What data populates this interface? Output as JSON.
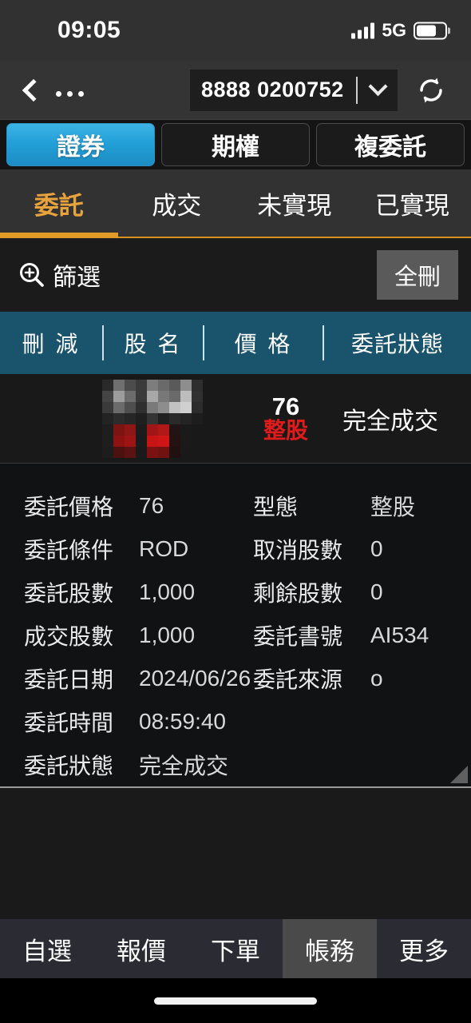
{
  "status_bar": {
    "time": "09:05",
    "network": "5G",
    "signal_icon": "cellular-signal-icon",
    "battery_icon": "battery-icon"
  },
  "nav_bar": {
    "back_icon": "back-chevron-icon",
    "more_icon": "ellipsis-icon",
    "account_number": "8888 0200752",
    "dropdown_icon": "chevron-down-icon",
    "refresh_icon": "refresh-icon"
  },
  "segments": {
    "items": [
      {
        "label": "證券",
        "active": true
      },
      {
        "label": "期權",
        "active": false
      },
      {
        "label": "複委託",
        "active": false
      }
    ],
    "active_color": "#23a0d8"
  },
  "tabs": {
    "items": [
      {
        "label": "委託",
        "active": true
      },
      {
        "label": "成交",
        "active": false
      },
      {
        "label": "未實現",
        "active": false
      },
      {
        "label": "已實現",
        "active": false
      }
    ],
    "active_color": "#e8a33d"
  },
  "filter_bar": {
    "filter_label": "篩選",
    "filter_icon": "magnifier-plus-icon",
    "delete_all_label": "全刪"
  },
  "table_header": {
    "columns": [
      "刪 減",
      "股 名",
      "價 格",
      "委託狀態"
    ]
  },
  "order_row": {
    "stock_name": "",
    "stock_name_masked": true,
    "price": "76",
    "price_type": "整股",
    "price_type_color": "#e01b1b",
    "status": "完全成交"
  },
  "detail": {
    "rows": [
      {
        "label_left": "委託價格",
        "value_left": "76",
        "label_right": "型態",
        "value_right": "整股"
      },
      {
        "label_left": "委託條件",
        "value_left": "ROD",
        "label_right": "取消股數",
        "value_right": "0"
      },
      {
        "label_left": "委託股數",
        "value_left": "1,000",
        "label_right": "剩餘股數",
        "value_right": "0"
      },
      {
        "label_left": "成交股數",
        "value_left": "1,000",
        "label_right": "委託書號",
        "value_right": "AI534"
      },
      {
        "label_left": "委託日期",
        "value_left": "2024/06/26",
        "label_right": "委託來源",
        "value_right": "o"
      },
      {
        "label_left": "委託時間",
        "value_left": "08:59:40",
        "label_right": "",
        "value_right": ""
      },
      {
        "label_left": "委託狀態",
        "value_left": "完全成交",
        "label_right": "",
        "value_right": ""
      }
    ],
    "resize_handle_icon": "resize-handle-icon"
  },
  "bottom_nav": {
    "items": [
      {
        "label": "自選",
        "active": false
      },
      {
        "label": "報價",
        "active": false
      },
      {
        "label": "下單",
        "active": false
      },
      {
        "label": "帳務",
        "active": true
      },
      {
        "label": "更多",
        "active": false
      }
    ]
  }
}
